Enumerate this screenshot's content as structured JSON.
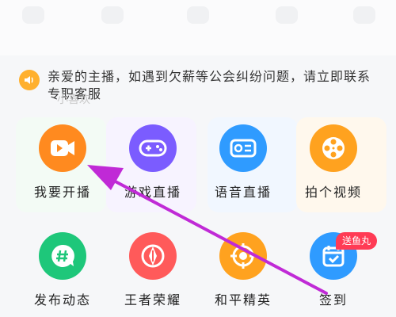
{
  "notice": {
    "text": "亲爱的主播，如遇到欠薪等公会纠纷问题，请立即联系专职客服",
    "faded_label": "小喜欢"
  },
  "grid": [
    {
      "label": "我要开播",
      "icon": "video-camera-icon",
      "color": "#ff8a1f"
    },
    {
      "label": "游戏直播",
      "icon": "gamepad-icon",
      "color": "#7b5cff"
    },
    {
      "label": "语音直播",
      "icon": "radio-icon",
      "color": "#2f9bff"
    },
    {
      "label": "拍个视频",
      "icon": "film-reel-icon",
      "color": "#ffa21f"
    },
    {
      "label": "发布动态",
      "icon": "hashtag-icon",
      "color": "#1ec77a"
    },
    {
      "label": "王者荣耀",
      "icon": "king-glory-icon",
      "color": "#ff5a5a"
    },
    {
      "label": "和平精英",
      "icon": "crosshair-icon",
      "color": "#ffa21f"
    },
    {
      "label": "签到",
      "icon": "calendar-check-icon",
      "color": "#2f9bff"
    }
  ],
  "badge": {
    "text": "送鱼丸"
  },
  "colors": {
    "arrow": "#c02ad6",
    "speaker": "#ffb02e"
  }
}
